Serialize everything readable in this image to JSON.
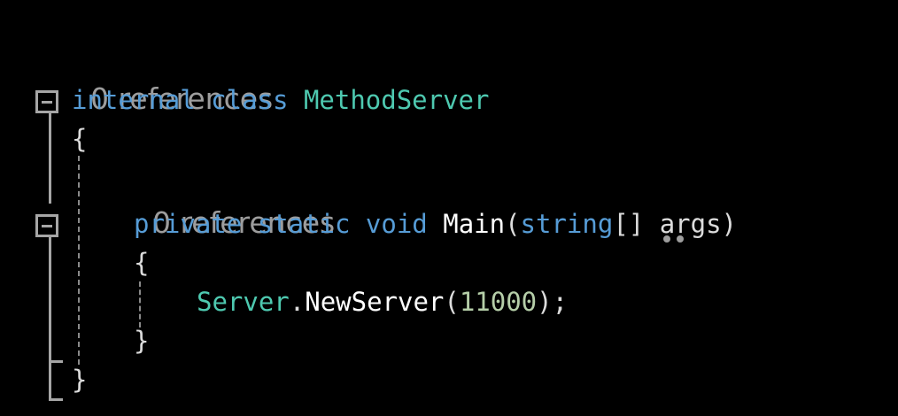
{
  "code": {
    "codelens_class": "0 references",
    "class_kw1": "internal",
    "class_kw2": "class",
    "class_name": "MethodServer",
    "class_open_brace": "{",
    "codelens_method": "0 references",
    "method_kw1": "private",
    "method_kw2": "static",
    "method_kw3": "void",
    "method_name": "Main",
    "method_paren_open": "(",
    "method_param_type": "string",
    "method_brackets": "[]",
    "method_param_name": "args",
    "method_paren_close": ")",
    "method_open_brace": "{",
    "stmt_type": "Server",
    "stmt_dot": ".",
    "stmt_method": "NewServer",
    "stmt_paren_open": "(",
    "stmt_arg": "11000",
    "stmt_end": ");",
    "method_close_brace": "}",
    "class_close_brace": "}"
  },
  "colors": {
    "background": "#000000",
    "keyword": "#569cd6",
    "type": "#4ec9b0",
    "number": "#b5cea8",
    "codelens": "#9d9d9d"
  }
}
